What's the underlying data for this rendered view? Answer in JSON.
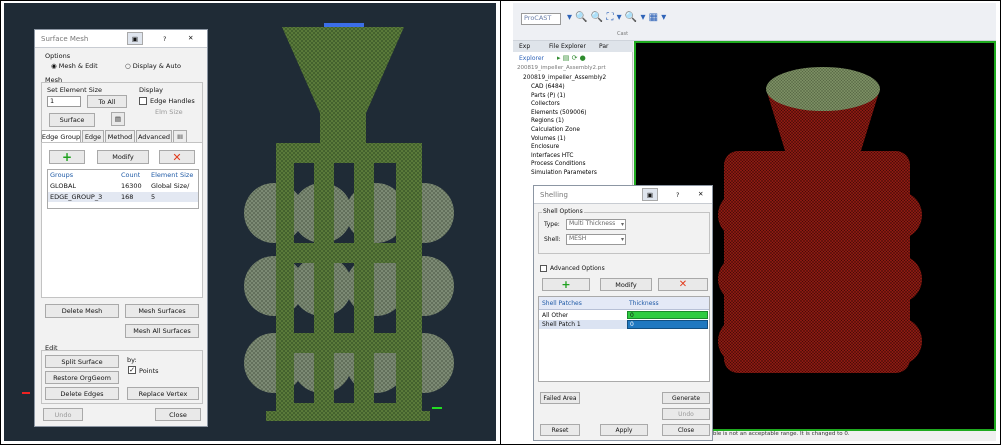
{
  "left_dialog": {
    "title": "Surface Mesh",
    "question": "?",
    "close": "✕",
    "options_label": "Options",
    "opt_mesh_edit": "Mesh & Edit",
    "opt_display_auto": "Display & Auto",
    "mesh_label": "Mesh",
    "set_elem_size": "Set Element Size",
    "elem_size_value": "1",
    "to_all": "To All",
    "display_label": "Display",
    "edge_handles": "Edge Handles",
    "elm_size": "Elm Size",
    "surface_btn": "Surface",
    "tabs": [
      "Edge Group",
      "Edge",
      "Method",
      "Advanced",
      "III"
    ],
    "modify": "Modify",
    "table_headers": [
      "Groups",
      "Count",
      "Element Size"
    ],
    "table_rows": [
      [
        "GLOBAL",
        "16300",
        "Global Size/"
      ],
      [
        "EDGE_GROUP_3",
        "168",
        "5"
      ]
    ],
    "delete_mesh": "Delete Mesh",
    "mesh_surfaces": "Mesh Surfaces",
    "mesh_all_surfaces": "Mesh All Surfaces",
    "edit_label": "Edit",
    "split_surface": "Split Surface",
    "restore_orggeom": "Restore OrgGeom",
    "delete_edges": "Delete Edges",
    "by_label": "by:",
    "points_label": "Points",
    "replace_vertex": "Replace Vertex",
    "undo": "Undo",
    "close_btn": "Close"
  },
  "right_app": {
    "toolbar_box": "ProCAST",
    "toolbar_sub": "Cast",
    "explorer_tabs": [
      "Exp",
      "File Explorer",
      "Par"
    ],
    "explorer_label": "Explorer",
    "file_name": "200819_impeller_Assembly2.prt",
    "tree_root": "200819_impeller_Assembly2",
    "tree_items": [
      "CAD (6484)",
      "Parts (P) (1)",
      "Collectors",
      "Elements (509006)",
      "Regions (1)",
      "Calculation Zone",
      "Volumes (1)",
      "Enclosure",
      "Interfaces HTC",
      "Process Conditions",
      "Simulation Parameters"
    ],
    "status_text": "ll in the \"Element Quality\" table is not an acceptable range. It is changed to 0."
  },
  "right_dialog": {
    "title": "Shelling",
    "question": "?",
    "close": "✕",
    "shell_options": "Shell Options",
    "type_label": "Type:",
    "type_value": "Multi Thickness",
    "shell_label": "Shell:",
    "shell_value": "MESH",
    "advanced_options": "Advanced Options",
    "modify": "Modify",
    "table_headers": [
      "Shell Patches",
      "Thickness"
    ],
    "table_rows": [
      [
        "All Other",
        "0"
      ],
      [
        "Shell Patch 1",
        "0"
      ]
    ],
    "failed_area": "Failed Area",
    "generate": "Generate",
    "undo": "Undo",
    "reset": "Reset",
    "apply": "Apply",
    "close_btn": "Close"
  },
  "colors": {
    "left_bg": "#1f2b36",
    "green_mesh": "#5a7a3a",
    "red_mesh": "#8a1a12",
    "selection_blue": "#1f78c0",
    "thickness_green": "#2ecc40"
  }
}
